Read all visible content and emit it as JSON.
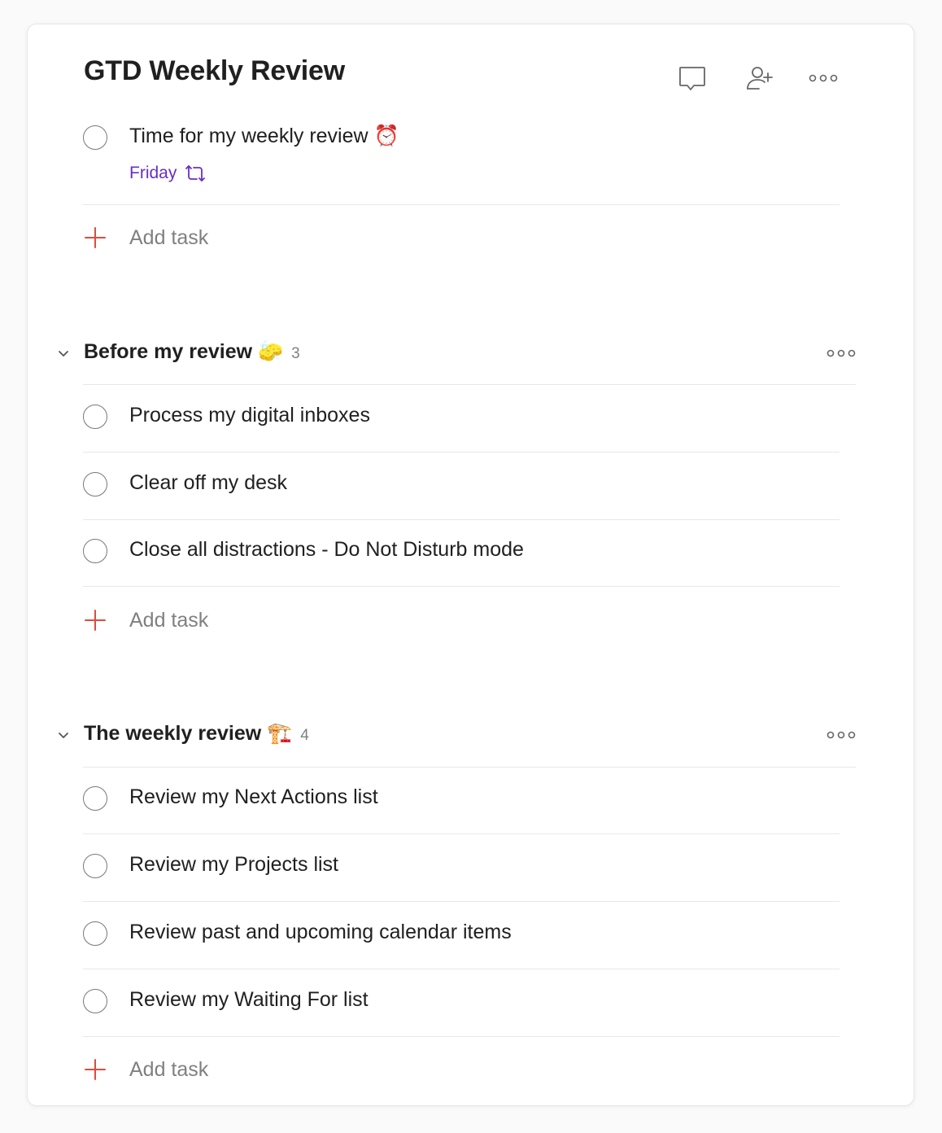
{
  "project": {
    "title": "GTD Weekly Review",
    "header_icons": [
      "comment-icon",
      "add-person-icon",
      "more-icon"
    ]
  },
  "top_task": {
    "text": "Time for my weekly review ⏰",
    "due": "Friday",
    "due_color": "#692fc2",
    "recurring_icon": "recurring-icon"
  },
  "add_task_label": "Add task",
  "accent_color": "#dc4c3e",
  "sections": [
    {
      "title": "Before my review 🧽",
      "count": "3",
      "tasks": [
        "Process my digital inboxes",
        "Clear off my desk",
        "Close all distractions - Do Not Disturb mode"
      ]
    },
    {
      "title": "The weekly review 🏗️",
      "count": "4",
      "tasks": [
        "Review my Next Actions list",
        "Review my Projects list",
        "Review past and upcoming calendar items",
        "Review my Waiting For list"
      ]
    }
  ]
}
